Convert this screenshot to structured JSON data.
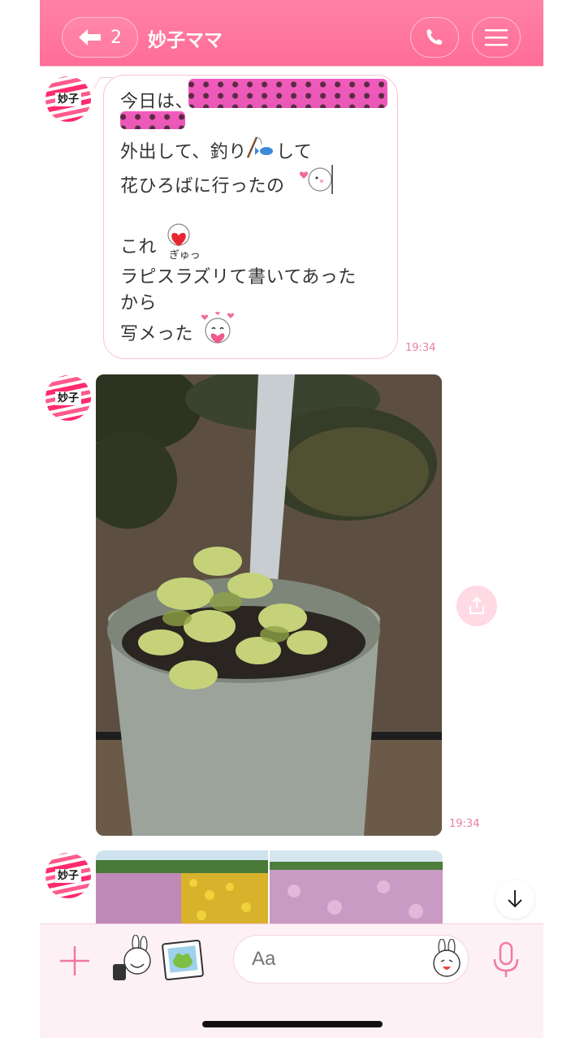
{
  "header": {
    "back_count": "2",
    "title": "妙子ママ",
    "accent": "#ff7aa0"
  },
  "avatar_text": "妙子",
  "messages": {
    "text_lines": [
      "今日は、",
      "外出して、釣り",
      "して",
      "花ひろばに行ったの",
      "これ",
      "ラピスラズリて書いてあった",
      "から",
      "写メった"
    ],
    "emoji_caption": "ぎゅっ",
    "text_time": "19:34",
    "photo_time": "19:34"
  },
  "icons": [
    "back-arrow-icon",
    "phone-icon",
    "menu-icon",
    "share-icon",
    "arrow-down-icon",
    "plus-icon",
    "sticker-icon",
    "photo-icon",
    "mic-icon"
  ],
  "input": {
    "placeholder": "Aa"
  },
  "colors": {
    "header": "#ff7aa0",
    "bubble_border": "#f7c5d4",
    "time": "#e8809f",
    "redaction": "#ee5ab9"
  }
}
